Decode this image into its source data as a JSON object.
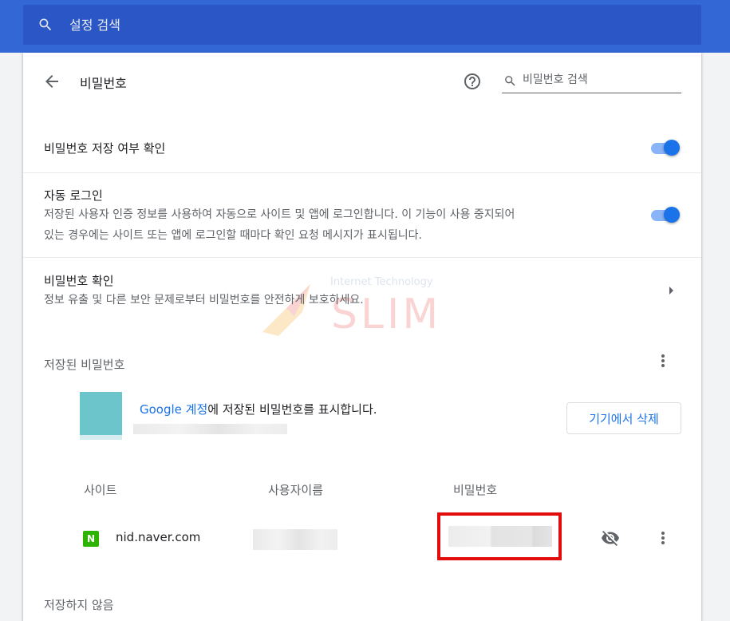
{
  "topbar": {
    "search_placeholder": "설정 검색",
    "search_icon": "search-icon"
  },
  "header": {
    "title": "비밀번호",
    "search_placeholder": "비밀번호 검색",
    "help_icon": "help-icon",
    "back_icon": "back-arrow-icon"
  },
  "settings": {
    "offer_to_save": {
      "label": "비밀번호 저장 여부 확인",
      "enabled": true
    },
    "auto_signin": {
      "label": "자동 로그인",
      "desc_line1": "저장된 사용자 인증 정보를 사용하여 자동으로 사이트 및 앱에 로그인합니다. 이 기능이 사용 중지되어",
      "desc_line2": "있는 경우에는 사이트 또는 앱에 로그인할 때마다 확인 요청 메시지가 표시됩니다.",
      "enabled": true
    },
    "check_passwords": {
      "label": "비밀번호 확인",
      "desc": "정보 유출 및 다른 보안 문제로부터 비밀번호를 안전하게 보호하세요."
    }
  },
  "watermark": {
    "small": "Internet Technology",
    "big": "SLIM"
  },
  "saved": {
    "section_title": "저장된 비밀번호",
    "account_link": "Google 계정",
    "account_text": "에 저장된 비밀번호를 표시합니다.",
    "delete_button": "기기에서 삭제",
    "columns": {
      "site": "사이트",
      "username": "사용자이름",
      "password": "비밀번호"
    },
    "rows": [
      {
        "site": "nid.naver.com",
        "badge": "N"
      }
    ]
  },
  "never_saved": {
    "section_title": "저장하지 않음"
  },
  "colors": {
    "accent": "#1a73e8",
    "topbar": "#3367d6",
    "highlight": "#e20c0c",
    "naver": "#2db400"
  }
}
